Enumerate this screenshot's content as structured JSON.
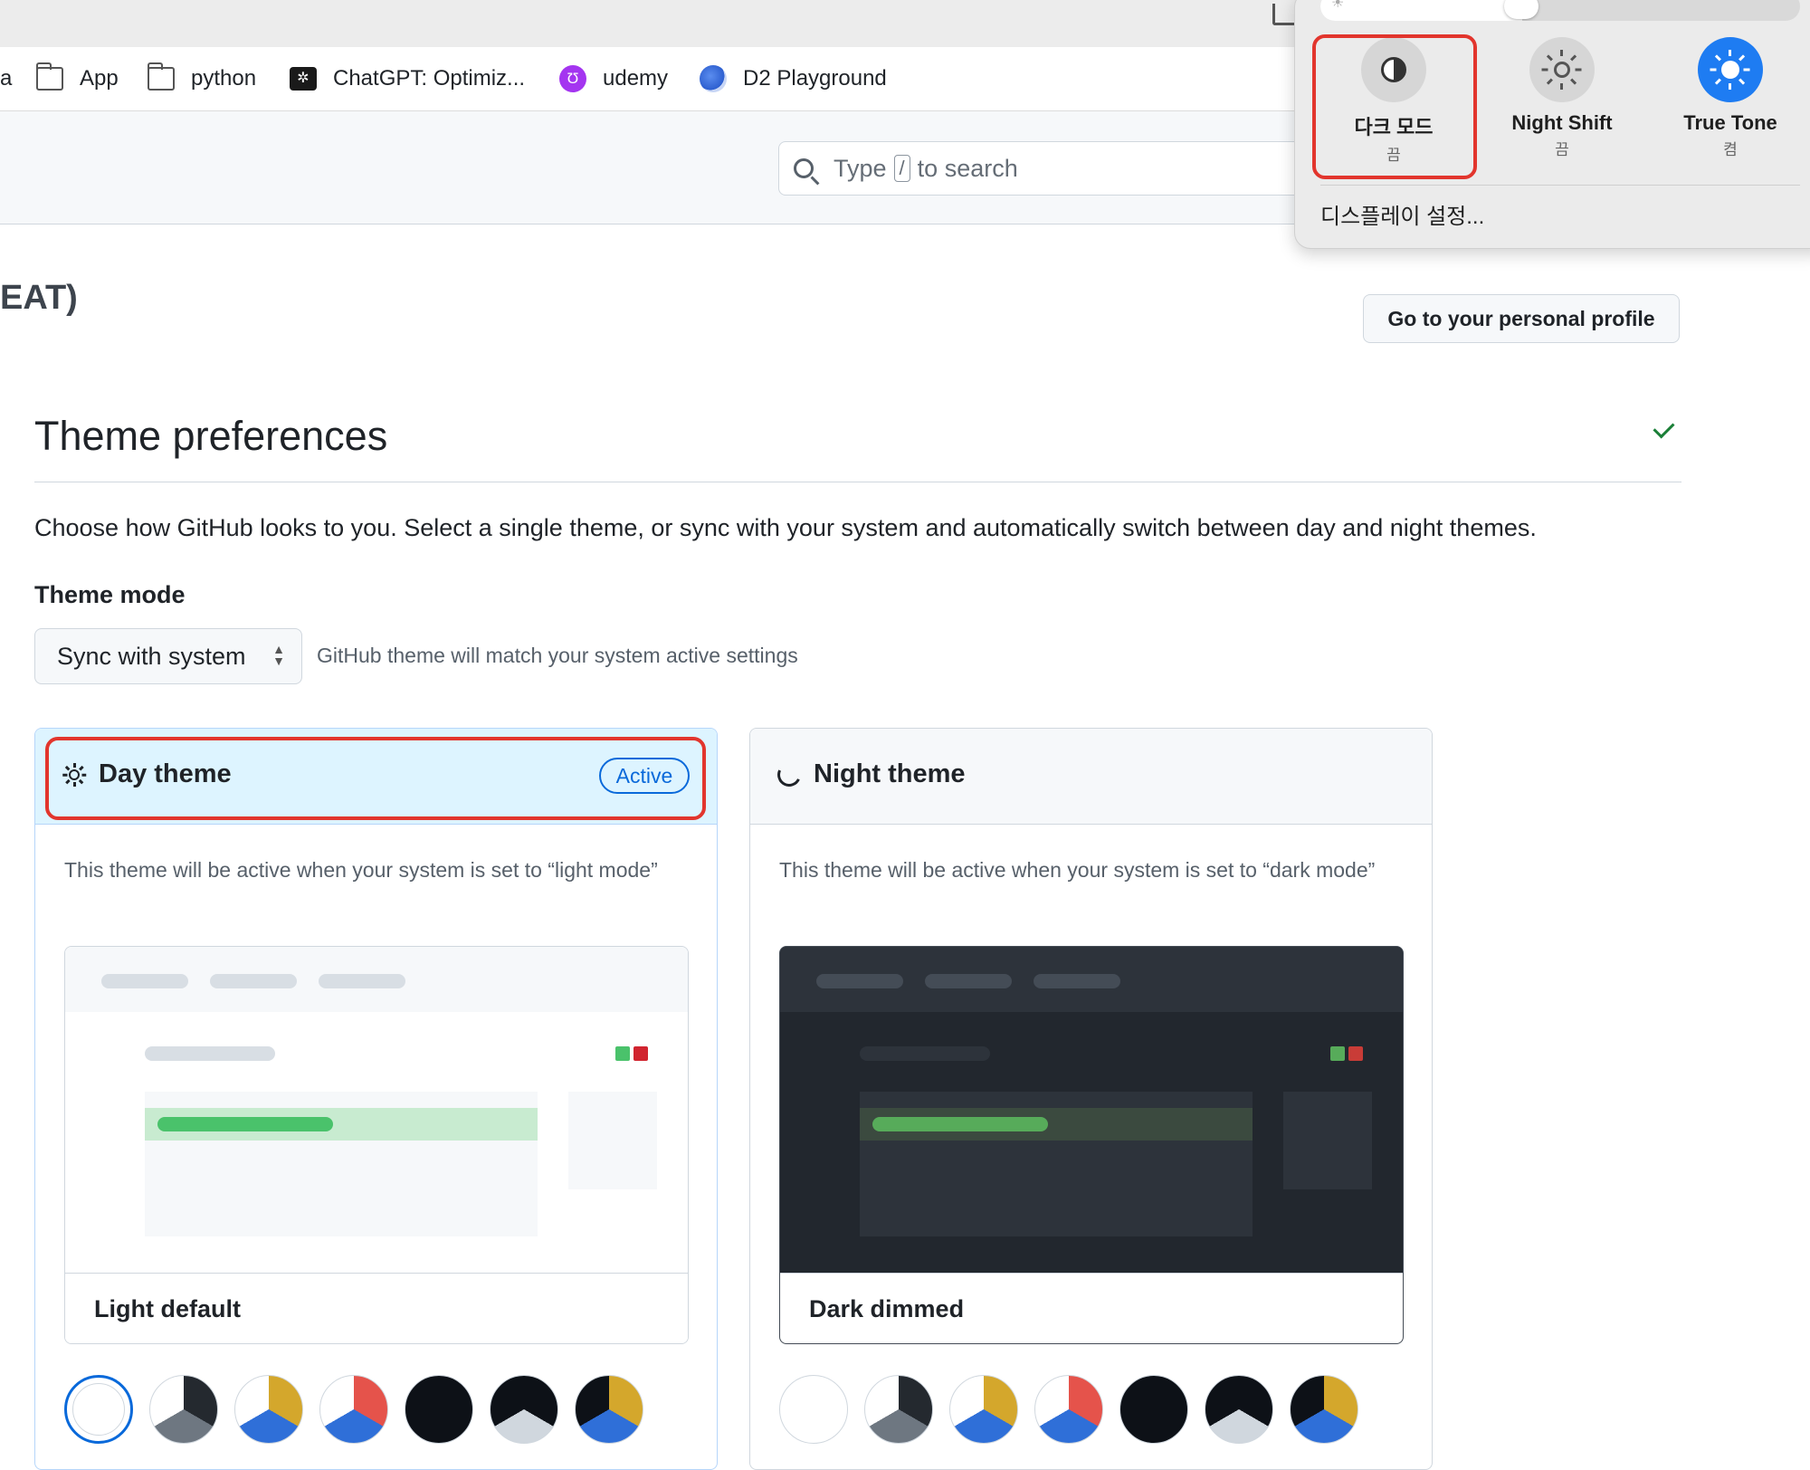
{
  "bookmarks": [
    {
      "label": "a",
      "icon": "folder-icon"
    },
    {
      "label": "App",
      "icon": "folder-icon"
    },
    {
      "label": "python",
      "icon": "folder-icon"
    },
    {
      "label": "ChatGPT: Optimiz...",
      "icon": "chatgpt-icon"
    },
    {
      "label": "udemy",
      "icon": "udemy-icon"
    },
    {
      "label": "D2 Playground",
      "icon": "d2-icon"
    }
  ],
  "header": {
    "search_prefix": "Type",
    "search_key": "/",
    "search_suffix": "to search"
  },
  "org": {
    "name_fragment": "EAT)",
    "profile_button": "Go to your personal profile"
  },
  "theme": {
    "title": "Theme preferences",
    "description": "Choose how GitHub looks to you. Select a single theme, or sync with your system and automatically switch between day and night themes.",
    "mode_label": "Theme mode",
    "mode_value": "Sync with system",
    "mode_hint": "GitHub theme will match your system active settings",
    "day": {
      "title": "Day theme",
      "badge": "Active",
      "description": "This theme will be active when your system is set to “light mode”",
      "preview_name": "Light default"
    },
    "night": {
      "title": "Night theme",
      "description": "This theme will be active when your system is set to “dark mode”",
      "preview_name": "Dark dimmed"
    }
  },
  "control_center": {
    "brightness": 0.42,
    "items": [
      {
        "label": "다크 모드",
        "status": "끔",
        "icon": "dark-mode-icon"
      },
      {
        "label": "Night Shift",
        "status": "끔",
        "icon": "night-shift-icon"
      },
      {
        "label": "True Tone",
        "status": "켬",
        "icon": "true-tone-icon"
      }
    ],
    "settings_link": "디스플레이 설정..."
  },
  "colors": {
    "accent": "#0969da",
    "highlight_border": "#e2352d",
    "success": "#1a7f37",
    "cc_active": "#1e7cf2"
  }
}
